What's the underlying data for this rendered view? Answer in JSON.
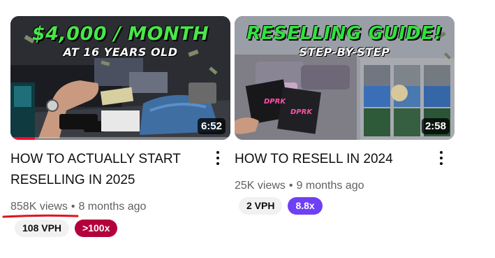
{
  "videos": [
    {
      "thumbnail": {
        "headline": "$4,000 / MONTH",
        "subline": "AT 16 YEARS OLD",
        "duration": "6:52",
        "watch_progress_fraction": 0.11
      },
      "title": "HOW TO ACTUALLY START RESELLING IN 2025",
      "views": "858K views",
      "separator": "•",
      "age": "8 months ago",
      "vph_badge": "108 VPH",
      "ratio_badge": ">100x",
      "ratio_badge_color": "#b3003c",
      "views_annotation_color": "#e0141c"
    },
    {
      "thumbnail": {
        "headline": "RESELLING GUIDE!",
        "subline": "STEP-BY-STEP",
        "duration": "2:58"
      },
      "title": "HOW TO RESELL IN 2024",
      "views": "25K views",
      "separator": "•",
      "age": "9 months ago",
      "vph_badge": "2 VPH",
      "ratio_badge": "8.8x",
      "ratio_badge_color": "#6f3ff5"
    }
  ],
  "icons": {
    "more": "more-vert-icon"
  },
  "colors": {
    "progress": "#ff0033",
    "headline_green": "#49e64a"
  }
}
